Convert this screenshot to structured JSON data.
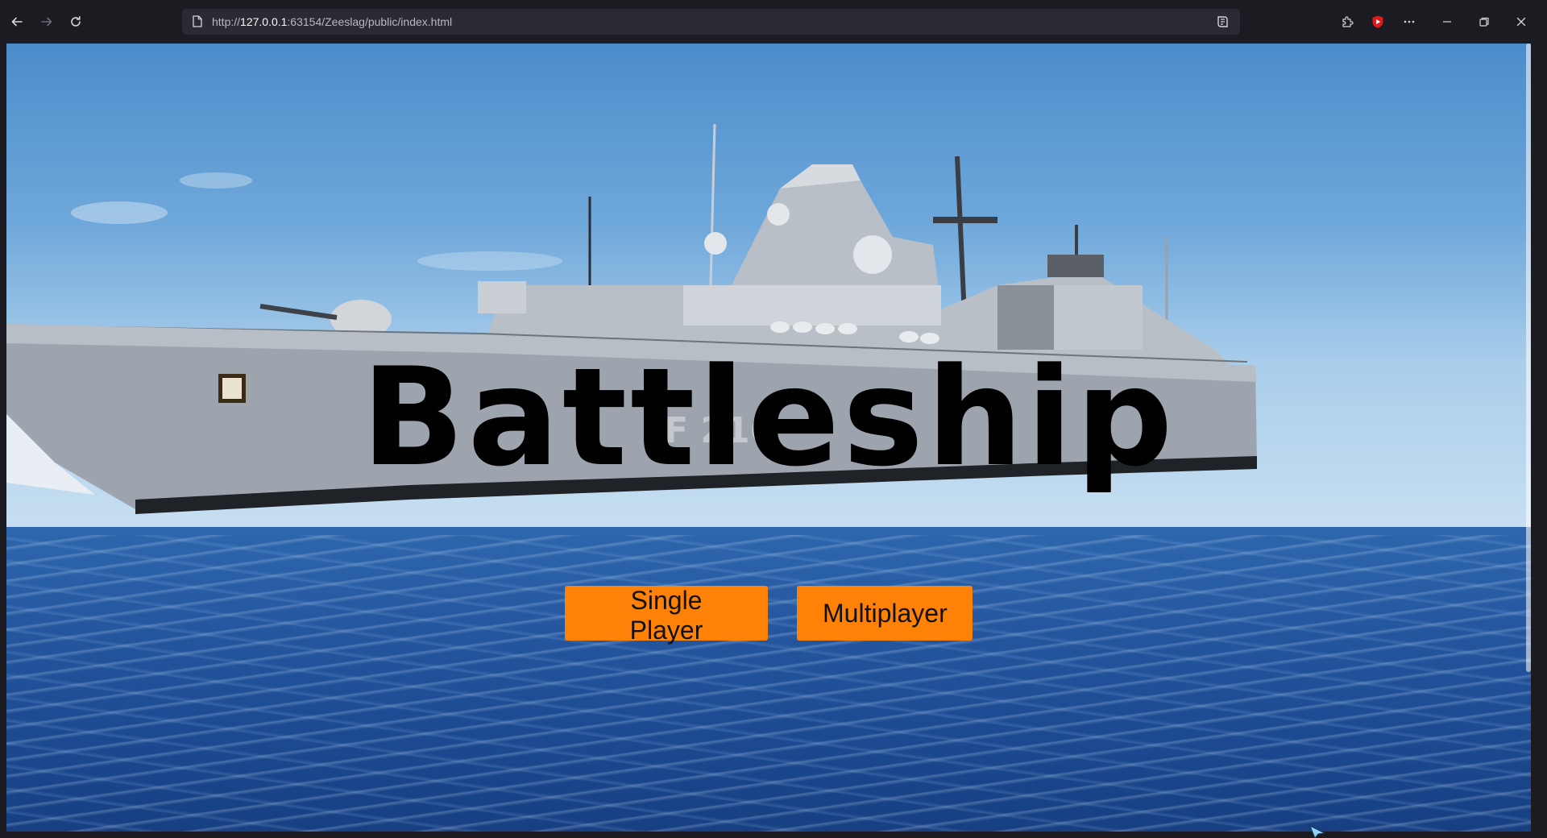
{
  "browser": {
    "url_prefix": "http://",
    "url_host": "127.0.0.1",
    "url_rest": ":63154/Zeeslag/public/index.html",
    "icons": {
      "back": "arrow-left-icon",
      "forward": "arrow-right-icon",
      "reload": "reload-icon",
      "page": "page-icon",
      "reader": "reader-view-icon",
      "extensions": "puzzle-icon",
      "youtube": "youtube-extension-icon",
      "menu": "more-icon",
      "minimize": "minimize-icon",
      "restore": "restore-icon",
      "close": "close-icon"
    },
    "colors": {
      "chrome_bg": "#1c1b22",
      "urlbar_bg": "#2b2a33",
      "youtube_red": "#ff0000"
    }
  },
  "page": {
    "title": "Battleship",
    "buttons": {
      "single_player": "Single Player",
      "multiplayer": "Multiplayer"
    },
    "background": "frigate-on-sea-photo",
    "colors": {
      "button_bg": "#ff8208",
      "title_color": "#000000"
    }
  }
}
